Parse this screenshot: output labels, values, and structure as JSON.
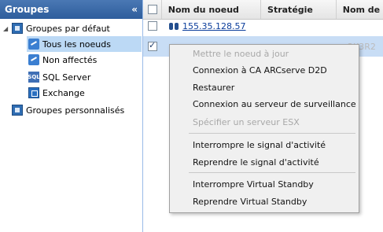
{
  "left_panel": {
    "title": "Groupes",
    "collapse_glyph": "«",
    "tree": [
      {
        "label": "Groupes par défaut",
        "icon": "group-icon"
      },
      {
        "label": "Tous les noeuds",
        "icon": "share-icon",
        "selected": true
      },
      {
        "label": "Non affectés",
        "icon": "share-icon"
      },
      {
        "label": "SQL Server",
        "icon": "sql-icon",
        "icon_text": "SQL"
      },
      {
        "label": "Exchange",
        "icon": "exchange-icon"
      },
      {
        "label": "Groupes personnalisés",
        "icon": "group-icon"
      }
    ]
  },
  "grid": {
    "columns": [
      "Nom du noeud",
      "Stratégie",
      "Nom de"
    ],
    "rows": [
      {
        "node": "155.35.128.57",
        "checked": false
      },
      {
        "node": "",
        "ghost": "2K3R2",
        "checked": true
      }
    ]
  },
  "context_menu": {
    "items": [
      {
        "label": "Mettre le noeud à jour",
        "disabled": true
      },
      {
        "label": "Connexion à CA ARCserve D2D",
        "disabled": false
      },
      {
        "label": "Restaurer",
        "disabled": false
      },
      {
        "label": "Connexion au serveur de surveillance",
        "disabled": false
      },
      {
        "label": "Spécifier un serveur ESX",
        "disabled": true
      },
      {
        "label": "Interrompre le signal d'activité",
        "disabled": false
      },
      {
        "label": "Reprendre le signal d'activité",
        "disabled": false
      },
      {
        "label": "Interrompre Virtual Standby",
        "disabled": false
      },
      {
        "label": "Reprendre Virtual Standby",
        "disabled": false
      }
    ]
  }
}
